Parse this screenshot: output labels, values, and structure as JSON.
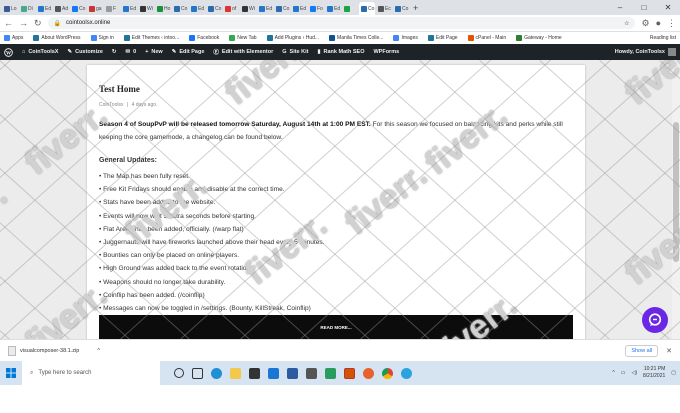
{
  "browser": {
    "tabs": [
      "Lo",
      "Di",
      "Ed",
      "Ad",
      "Co",
      "ga",
      "F",
      "Ed",
      "Wi",
      "Ho",
      "Co",
      "Ed",
      "Co",
      "of",
      "Wi",
      "Ed",
      "Co",
      "Ed",
      "Fo",
      "Ed",
      "",
      "Co",
      "Ec",
      "Co"
    ],
    "active_tab_index": 21,
    "url": "cointoolsx.online",
    "bookmarks": [
      "Apps",
      "About WordPress",
      "Sign in",
      "Edit Themes ‹ intoo...",
      "Facebook",
      "New Tab",
      "Add Plugins ‹ Hud...",
      "Manila Times Colle...",
      "Images",
      "Edit Page",
      "cPanel - Main",
      "Gateway - Home"
    ],
    "reading_list": "Reading list"
  },
  "wp_admin": {
    "site_name": "CoinToolsX",
    "customize": "Customize",
    "comments_count": "0",
    "new_label": "New",
    "edit_page": "Edit Page",
    "elementor": "Edit with Elementor",
    "site_kit": "Site Kit",
    "rank_math": "Rank Math SEO",
    "wpforms": "WPForms",
    "howdy": "Howdy, CoinToolsx"
  },
  "post": {
    "title": "Test Home",
    "author": "CoinToolsx",
    "date": "4 days ago.",
    "intro_bold": "Season 4 of SoupPvP will be released tomorrow Saturday, August 14th at 1:00 PM EST.",
    "intro_rest": " For this season we focused on balancing kits and perks while still keeping the core gamemode, a changelog can be found below.",
    "updates_heading": "General Updates:",
    "updates": [
      "• The Map has been fully reset.",
      "• Free Kit Fridays should enable and disable at the correct time.",
      "• Stats have been added to the website.",
      "• Events will now wait 5 extra seconds before starting.",
      "• Flat Arena has been added, officially. (/warp flat)",
      "• Juggernauts will have fireworks launched above their head every 5 minutes.",
      "• Bounties can only be placed on online players.",
      "• High Ground was added back to the event rotation.",
      "• Weapons should no longer take durability.",
      "• Coinflip has been added. (/coinflip)",
      "• Messages can now be toggled in /settings. (Bounty, KillStreak, Coinflip)"
    ],
    "video_caption": "READ MORE..."
  },
  "watermark_text": "fiverr.",
  "download": {
    "filename": "visualcomposer-38.1.zip",
    "show_all": "Show all"
  },
  "taskbar": {
    "search_placeholder": "Type here to search",
    "time": "10:21 PM",
    "date": "8/21/2021"
  },
  "colors": {
    "wp_bar": "#1d2327",
    "chat_bubble": "#6a28e6",
    "taskbar": "#d6e3f0"
  }
}
